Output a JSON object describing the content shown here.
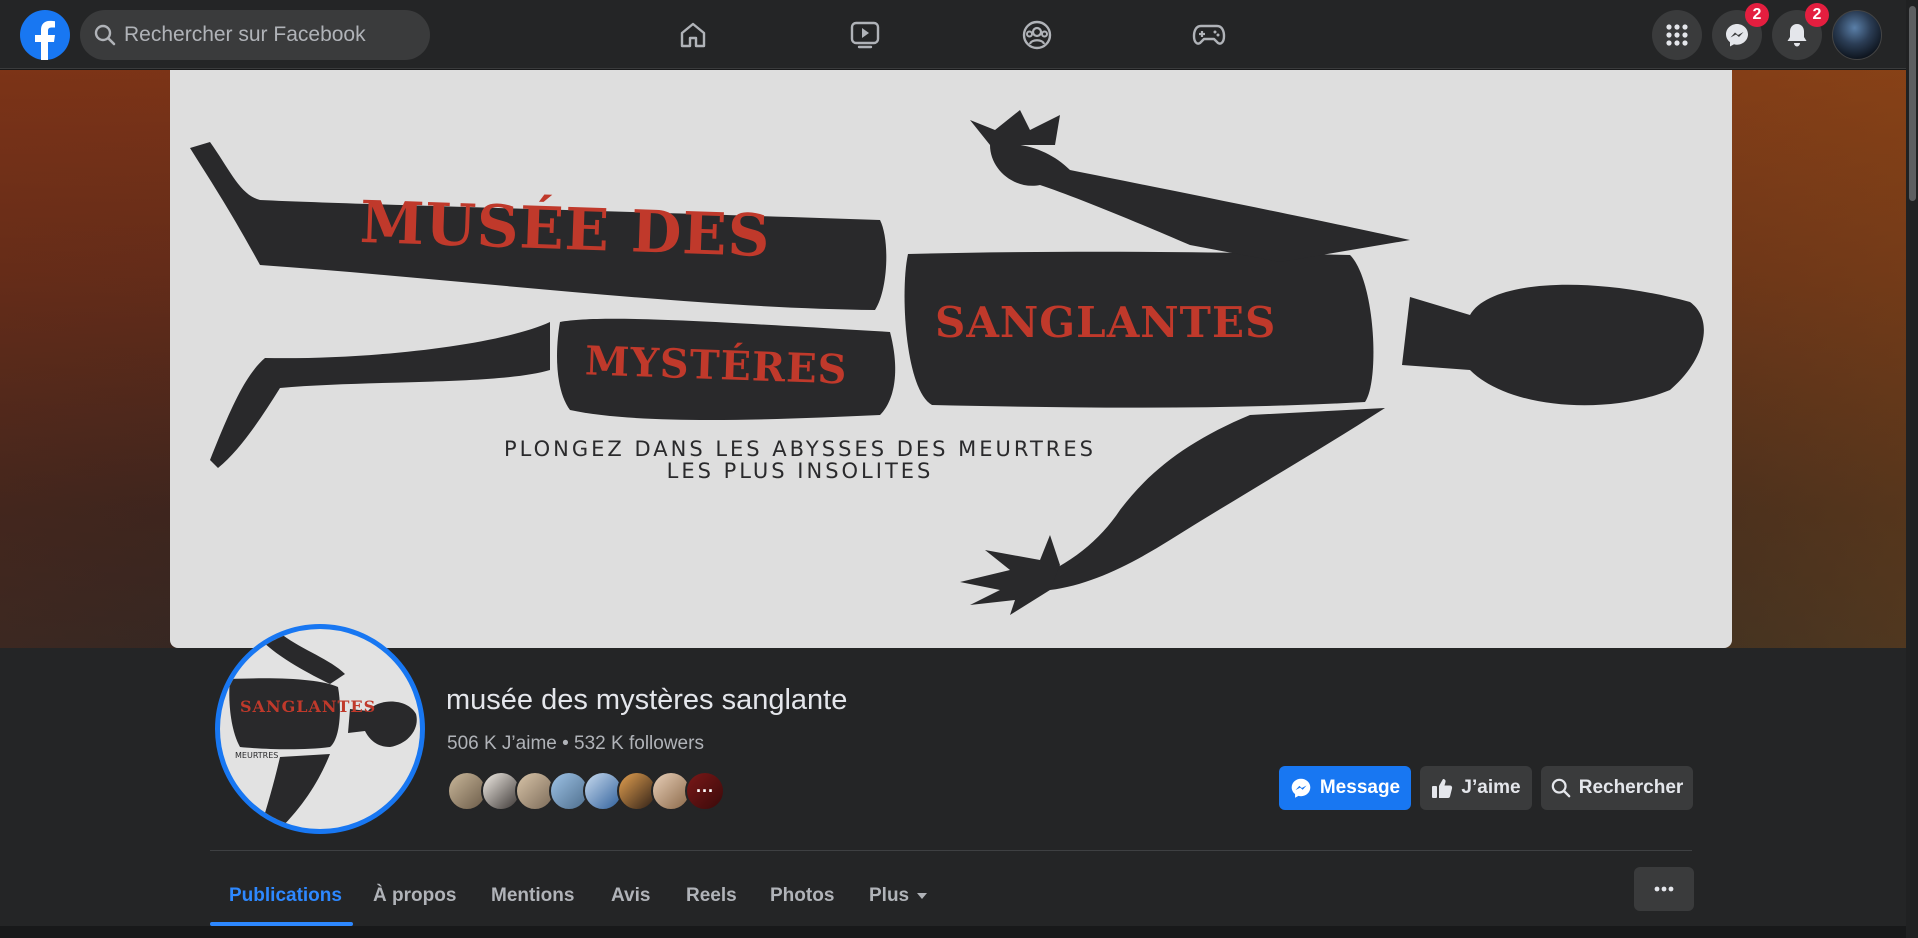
{
  "topbar": {
    "search_placeholder": "Rechercher sur Facebook",
    "nav": [
      "home-icon",
      "watch-icon",
      "groups-icon",
      "gaming-icon"
    ],
    "menu_icon": "grid-menu-icon",
    "messenger_badge": "2",
    "notifications_badge": "2"
  },
  "cover": {
    "line1": "MUSÉE DES",
    "line2": "MYSTÉRES",
    "line3": "SANGLANTES",
    "tagline_line1": "PLONGEZ DANS LES ABYSSES DES MEURTRES",
    "tagline_line2": "LES PLUS INSOLITES"
  },
  "profile": {
    "picture_text": "SANGLANTES",
    "picture_subtext": "MEURTRES",
    "name": "musée des mystères sanglante",
    "stats": "506 K J’aime • 532 K followers",
    "friends_more": "···"
  },
  "actions": {
    "message": "Message",
    "like": "J’aime",
    "search": "Rechercher"
  },
  "tabs": {
    "posts": "Publications",
    "about": "À propos",
    "mentions": "Mentions",
    "reviews": "Avis",
    "reels": "Reels",
    "photos": "Photos",
    "more": "Plus"
  },
  "colors": {
    "accent": "#1877f2",
    "badge": "#e41e3f",
    "cover_text": "#c0392b"
  }
}
